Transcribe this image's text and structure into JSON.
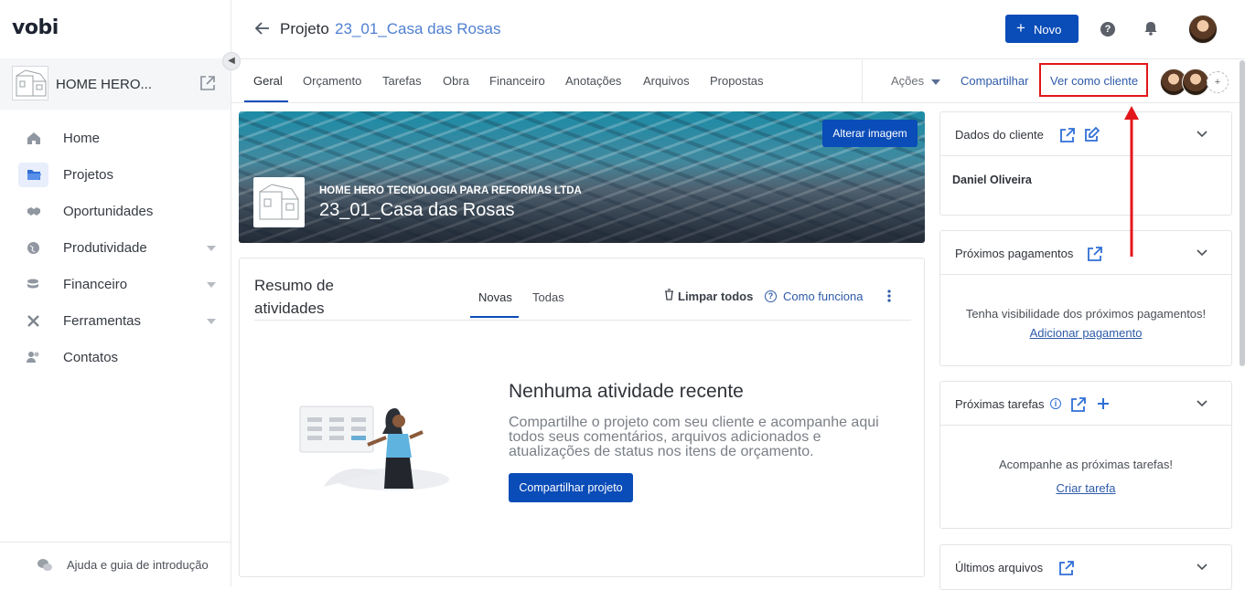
{
  "app": {
    "logo": "vobi"
  },
  "sidebar": {
    "company_name": "HOME HERO...",
    "items": [
      {
        "label": "Home",
        "icon": "home-icon",
        "has_caret": false
      },
      {
        "label": "Projetos",
        "icon": "folder-icon",
        "has_caret": false,
        "active": true
      },
      {
        "label": "Oportunidades",
        "icon": "handshake-icon",
        "has_caret": false
      },
      {
        "label": "Produtividade",
        "icon": "globe-icon",
        "has_caret": true
      },
      {
        "label": "Financeiro",
        "icon": "coins-icon",
        "has_caret": true
      },
      {
        "label": "Ferramentas",
        "icon": "tools-icon",
        "has_caret": true
      },
      {
        "label": "Contatos",
        "icon": "contacts-icon",
        "has_caret": false
      }
    ],
    "help_label": "Ajuda e guia de introdução"
  },
  "header": {
    "prefix": "Projeto",
    "project_name": "23_01_Casa das Rosas",
    "new_button": "Novo",
    "new_plus": "+",
    "help_glyph": "?"
  },
  "tabs": {
    "items": [
      "Geral",
      "Orçamento",
      "Tarefas",
      "Obra",
      "Financeiro",
      "Anotações",
      "Arquivos",
      "Propostas"
    ],
    "active": "Geral",
    "actions_label": "Ações",
    "share_label": "Compartilhar",
    "view_as_client_label": "Ver como cliente",
    "add_member_glyph": "+"
  },
  "banner": {
    "change_image_button": "Alterar imagem",
    "company": "HOME HERO TECNOLOGIA PARA REFORMAS LTDA",
    "project": "23_01_Casa das Rosas"
  },
  "activity": {
    "title": "Resumo de atividades",
    "tabs": [
      "Novas",
      "Todas"
    ],
    "clear_all": "Limpar todos",
    "how_it_works": "Como funciona",
    "how_glyph": "?",
    "empty_title": "Nenhuma atividade recente",
    "empty_text": "Compartilhe o projeto com seu cliente e acompanhe aqui todos seus comentários, arquivos adicionados e atualizações de status nos itens de orçamento.",
    "share_button": "Compartilhar projeto"
  },
  "cards": {
    "client": {
      "title": "Dados do cliente",
      "name": "Daniel Oliveira"
    },
    "payments": {
      "title": "Próximos pagamentos",
      "text": "Tenha visibilidade dos próximos pagamentos!",
      "link": "Adicionar pagamento"
    },
    "tasks": {
      "title": "Próximas tarefas",
      "info_glyph": "i",
      "text": "Acompanhe as próximas tarefas!",
      "link": "Criar tarefa"
    },
    "files": {
      "title": "Últimos arquivos"
    }
  },
  "colors": {
    "primary": "#0a4cb8",
    "link": "#2e5aa8",
    "highlight": "#e3161b"
  }
}
